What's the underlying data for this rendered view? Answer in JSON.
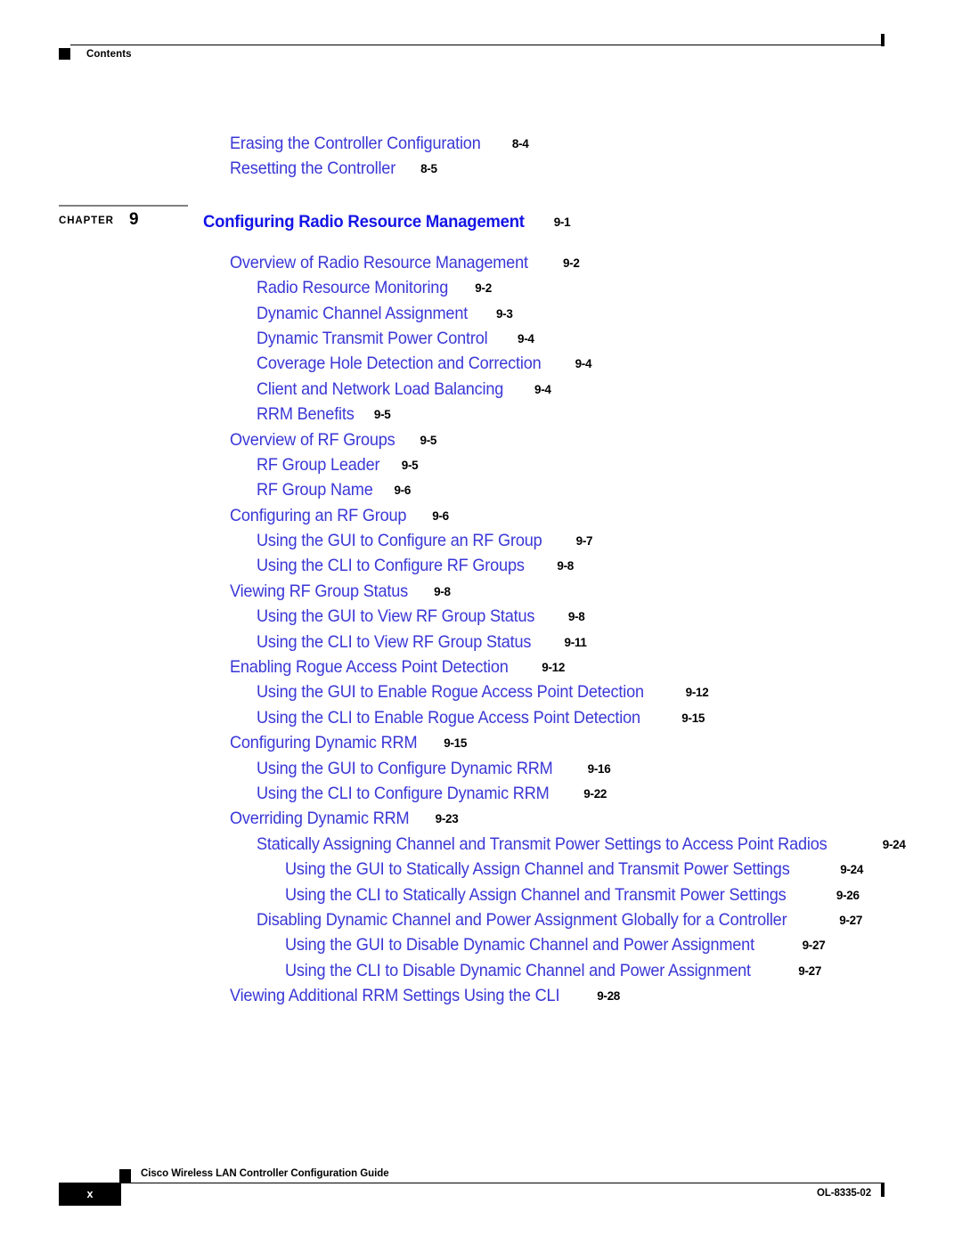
{
  "header": {
    "label": "Contents"
  },
  "chapter": {
    "label": "CHAPTER",
    "number": "9",
    "title": "Configuring Radio Resource Management",
    "page": "9-1"
  },
  "toc_before_chapter": [
    {
      "level": 1,
      "title": "Erasing the Controller Configuration",
      "page": "8-4"
    },
    {
      "level": 1,
      "title": "Resetting the Controller",
      "page": "8-5"
    }
  ],
  "toc_entries": [
    {
      "level": 1,
      "title": "Overview of Radio Resource Management",
      "page": "9-2"
    },
    {
      "level": 2,
      "title": "Radio Resource Monitoring",
      "page": "9-2"
    },
    {
      "level": 2,
      "title": "Dynamic Channel Assignment",
      "page": "9-3"
    },
    {
      "level": 2,
      "title": "Dynamic Transmit Power Control",
      "page": "9-4"
    },
    {
      "level": 2,
      "title": "Coverage Hole Detection and Correction",
      "page": "9-4"
    },
    {
      "level": 2,
      "title": "Client and Network Load Balancing",
      "page": "9-4"
    },
    {
      "level": 2,
      "title": "RRM Benefits",
      "page": "9-5"
    },
    {
      "level": 1,
      "title": "Overview of RF Groups",
      "page": "9-5"
    },
    {
      "level": 2,
      "title": "RF Group Leader",
      "page": "9-5"
    },
    {
      "level": 2,
      "title": "RF Group Name",
      "page": "9-6"
    },
    {
      "level": 1,
      "title": "Configuring an RF Group",
      "page": "9-6"
    },
    {
      "level": 2,
      "title": "Using the GUI to Configure an RF Group",
      "page": "9-7"
    },
    {
      "level": 2,
      "title": "Using the CLI to Configure RF Groups",
      "page": "9-8"
    },
    {
      "level": 1,
      "title": "Viewing RF Group Status",
      "page": "9-8"
    },
    {
      "level": 2,
      "title": "Using the GUI to View RF Group Status",
      "page": "9-8"
    },
    {
      "level": 2,
      "title": "Using the CLI to View RF Group Status",
      "page": "9-11"
    },
    {
      "level": 1,
      "title": "Enabling Rogue Access Point Detection",
      "page": "9-12"
    },
    {
      "level": 2,
      "title": "Using the GUI to Enable Rogue Access Point Detection",
      "page": "9-12"
    },
    {
      "level": 2,
      "title": "Using the CLI to Enable Rogue Access Point Detection",
      "page": "9-15"
    },
    {
      "level": 1,
      "title": "Configuring Dynamic RRM",
      "page": "9-15"
    },
    {
      "level": 2,
      "title": "Using the GUI to Configure Dynamic RRM",
      "page": "9-16"
    },
    {
      "level": 2,
      "title": "Using the CLI to Configure Dynamic RRM",
      "page": "9-22"
    },
    {
      "level": 1,
      "title": "Overriding Dynamic RRM",
      "page": "9-23"
    },
    {
      "level": 3,
      "title": "Statically Assigning Channel and Transmit Power Settings to Access Point Radios",
      "page": "9-24"
    },
    {
      "level": 4,
      "title": "Using the GUI to Statically Assign Channel and Transmit Power Settings",
      "page": "9-24"
    },
    {
      "level": 4,
      "title": "Using the CLI to Statically Assign Channel and Transmit Power Settings",
      "page": "9-26"
    },
    {
      "level": 3,
      "title": "Disabling Dynamic Channel and Power Assignment Globally for a Controller",
      "page": "9-27"
    },
    {
      "level": 4,
      "title": "Using the GUI to Disable Dynamic Channel and Power Assignment",
      "page": "9-27"
    },
    {
      "level": 4,
      "title": "Using the CLI to Disable Dynamic Channel and Power Assignment",
      "page": "9-27"
    },
    {
      "level": 1,
      "title": "Viewing Additional RRM Settings Using the CLI",
      "page": "9-28"
    }
  ],
  "footer": {
    "guide_title": "Cisco Wireless LAN Controller Configuration Guide",
    "page_number": "x",
    "doc_id": "OL-8335-02"
  }
}
